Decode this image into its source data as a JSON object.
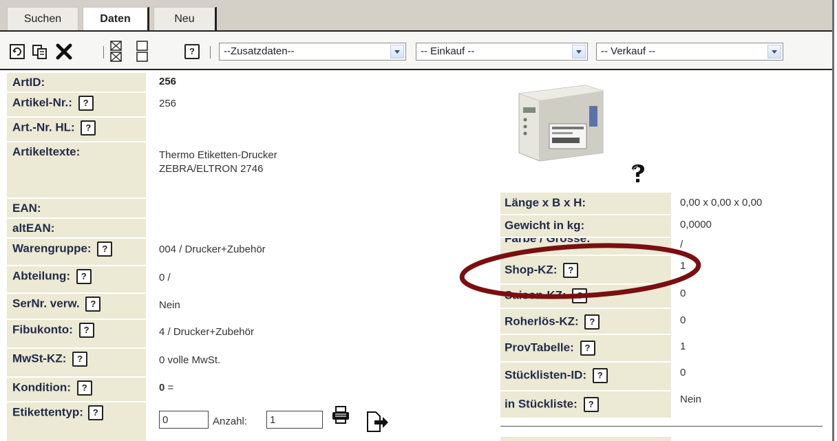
{
  "tabs": [
    {
      "label": "Suchen"
    },
    {
      "label": "Daten"
    },
    {
      "label": "Neu"
    }
  ],
  "toolbar": {
    "icons": [
      "refresh-icon",
      "copy-icon",
      "delete-icon",
      "grid-toggle-icon",
      "layout-icon",
      "help-icon"
    ],
    "help_label": "?",
    "selects": {
      "zusatzdaten": "--Zusatzdaten--",
      "einkauf": "-- Einkauf --",
      "verkauf": "-- Verkauf --"
    }
  },
  "left_fields": {
    "artid": {
      "label": "ArtID:",
      "value": "256"
    },
    "artikel_nr": {
      "label": "Artikel-Nr.:",
      "value": "256"
    },
    "art_nr_hl": {
      "label": "Art.-Nr. HL:",
      "value": ""
    },
    "artikeltexte": {
      "label": "Artikeltexte:",
      "line1": "Thermo Etiketten-Drucker",
      "line2": "ZEBRA/ELTRON 2746"
    },
    "ean": {
      "label": "EAN:",
      "value": ""
    },
    "alt_ean": {
      "label": "altEAN:",
      "value": ""
    },
    "warengruppe": {
      "label": "Warengruppe:",
      "value": "004 / Drucker+Zubehör"
    },
    "abteilung": {
      "label": "Abteilung:",
      "value": "0 /"
    },
    "sernr": {
      "label": "SerNr. verw.",
      "value": "Nein"
    },
    "fibukonto": {
      "label": "Fibukonto:",
      "value": "4 / Drucker+Zubehör"
    },
    "mwst": {
      "label": "MwSt-KZ:",
      "value": "0  volle MwSt."
    },
    "kondition": {
      "label": "Kondition:",
      "value_bold": "0",
      "value_rest": " ="
    },
    "etikettentyp": {
      "label": "Etikettentyp:",
      "input_value": "0",
      "anzahl_label": "Anzahl:",
      "anzahl_value": "1"
    }
  },
  "right_fields": {
    "laenge": {
      "label": "Länge x B x H:",
      "value": "0,00 x 0,00 x 0,00"
    },
    "gewicht": {
      "label": "Gewicht in kg:",
      "value": "0,0000"
    },
    "farbe": {
      "label": "Farbe / Grösse:",
      "value": "/"
    },
    "shop_kz": {
      "label": "Shop-KZ:",
      "value": "1"
    },
    "saison_kz": {
      "label": "Saison-KZ:",
      "value": "0"
    },
    "roherloes_kz": {
      "label": "Roherlös-KZ:",
      "value": "0"
    },
    "provtabelle": {
      "label": "ProvTabelle:",
      "value": "1"
    },
    "stuecklisten_id": {
      "label": "Stücklisten-ID:",
      "value": "0"
    },
    "in_stueckliste": {
      "label": "in Stückliste:",
      "value": "Nein"
    }
  },
  "image": {
    "semantic": "thermal-label-printer",
    "help_icon": "question-mark-icon"
  },
  "annotation": {
    "color": "#7a0f10",
    "shape": "ellipse",
    "target": "Shop-KZ"
  },
  "colors": {
    "label_bg": "#ece9d4",
    "label_text": "#1f2a48",
    "tabbar_bg": "#d4d0c8"
  }
}
